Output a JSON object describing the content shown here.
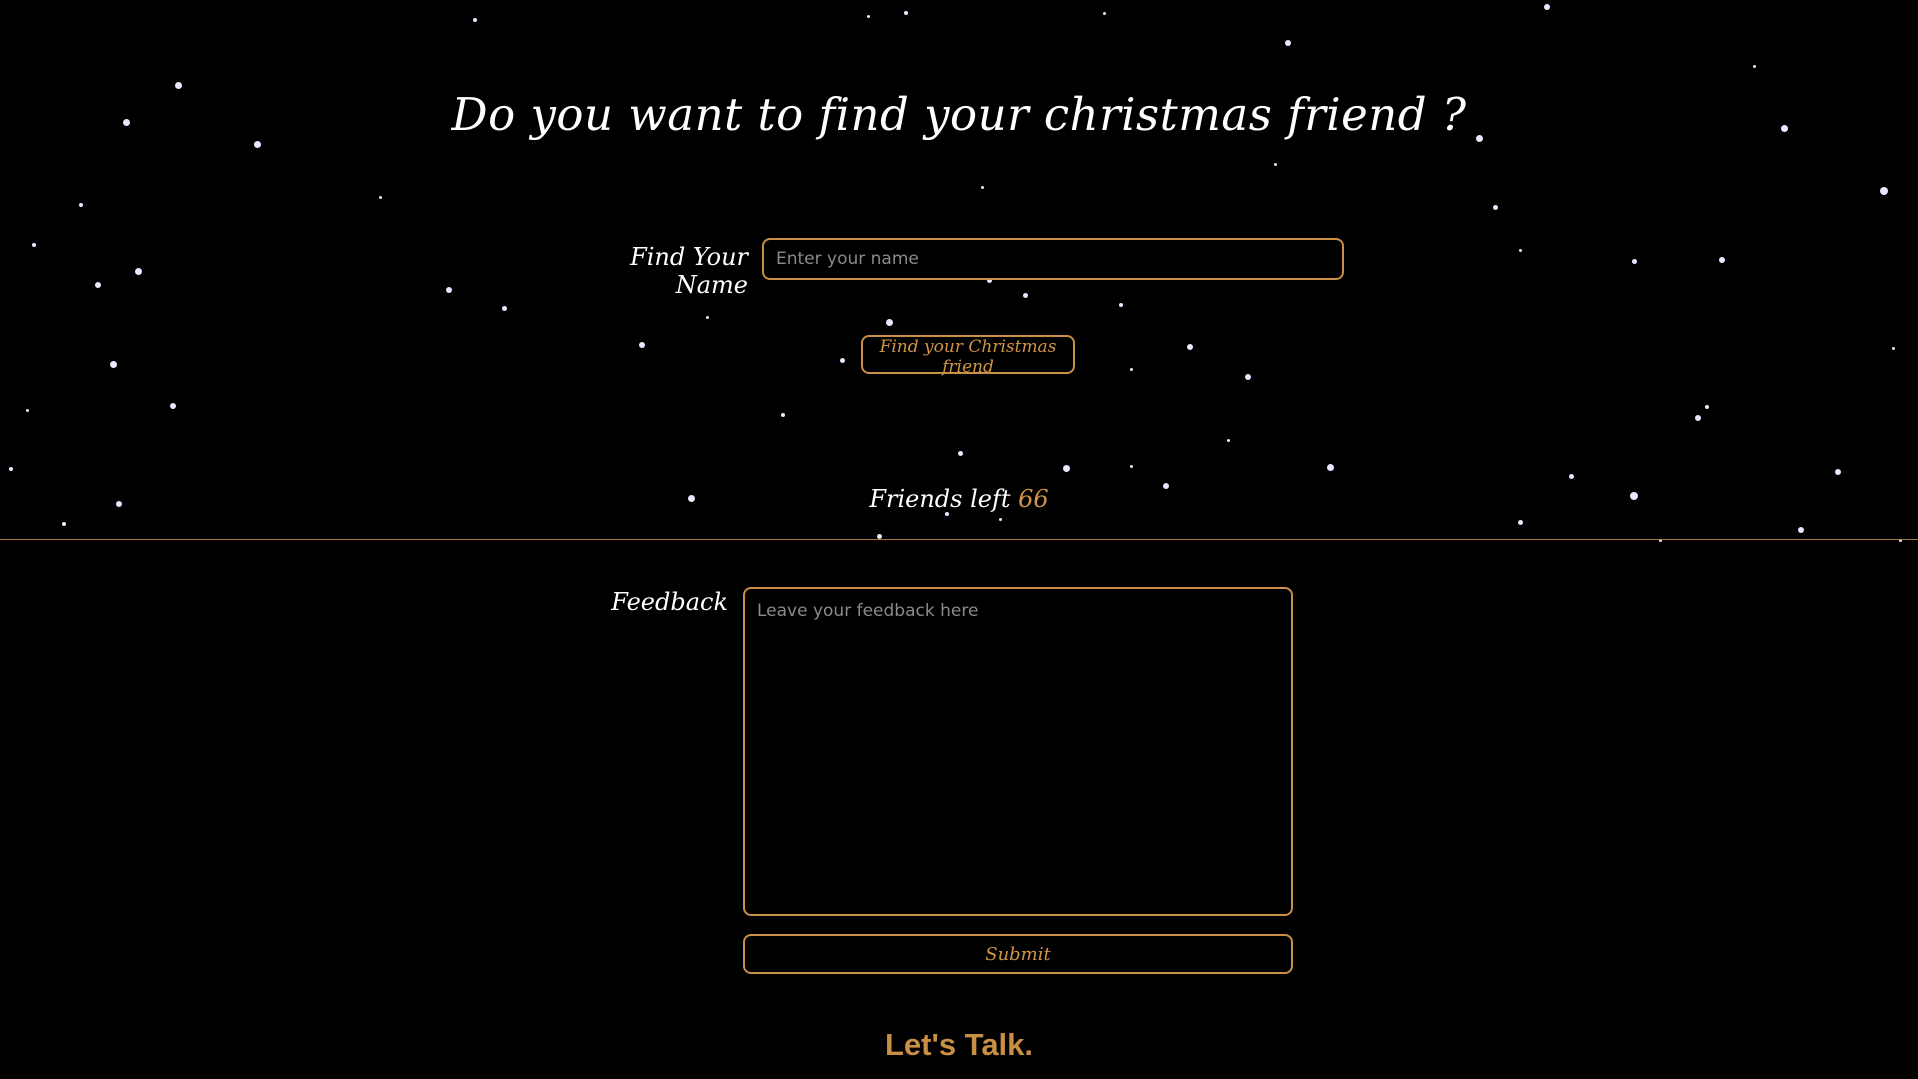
{
  "colors": {
    "background": "#000000",
    "accent": "#c88f45",
    "accent_text": "#d19447",
    "text": "#ffffff",
    "snowflake": "#e6e9ff",
    "placeholder": "#8a8a8a"
  },
  "title": "Do you want to find your christmas friend ?",
  "find_form": {
    "label": "Find Your Name",
    "input_placeholder": "Enter your name",
    "input_value": "",
    "button_label": "Find your Christmas friend"
  },
  "friends_left": {
    "label": "Friends left",
    "count": "66"
  },
  "feedback_form": {
    "label": "Feedback",
    "textarea_placeholder": "Leave your feedback here",
    "textarea_value": "",
    "submit_label": "Submit"
  },
  "footer": {
    "heading": "Let's Talk."
  }
}
